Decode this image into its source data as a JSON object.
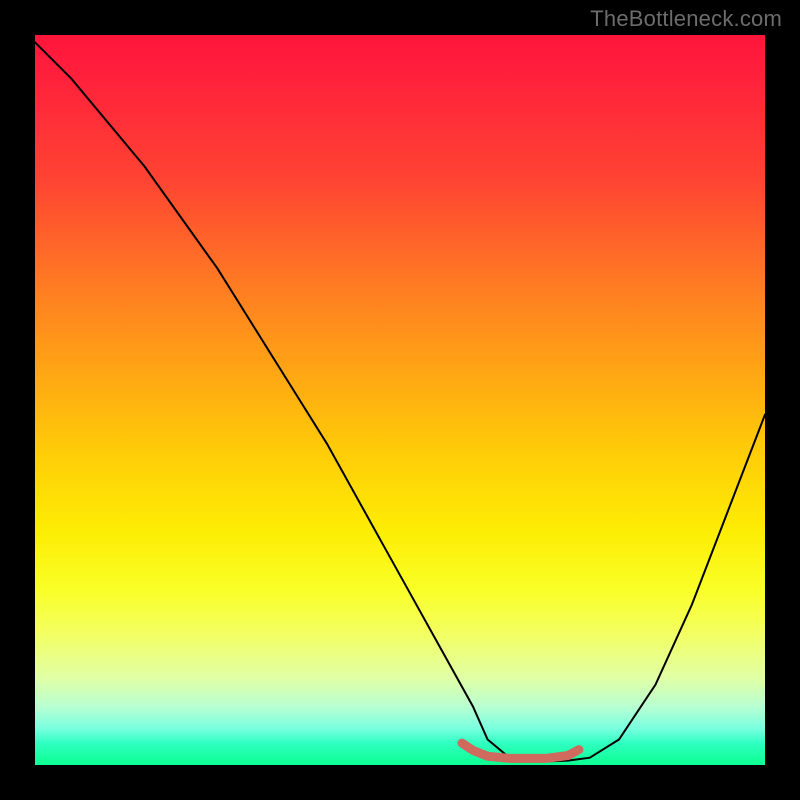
{
  "watermark": {
    "text": "TheBottleneck.com"
  },
  "chart_data": {
    "type": "line",
    "title": "",
    "xlabel": "",
    "ylabel": "",
    "xlim": [
      0,
      100
    ],
    "ylim": [
      0,
      100
    ],
    "grid": false,
    "legend": false,
    "background_gradient": {
      "direction": "vertical",
      "stops": [
        {
          "pos": 0,
          "color": "#ff153b"
        },
        {
          "pos": 20,
          "color": "#ff4432"
        },
        {
          "pos": 46,
          "color": "#ffa514"
        },
        {
          "pos": 68,
          "color": "#fded04"
        },
        {
          "pos": 88,
          "color": "#e1ffa5"
        },
        {
          "pos": 100,
          "color": "#0cff90"
        }
      ]
    },
    "series": [
      {
        "name": "bottleneck-curve",
        "color": "#000000",
        "x": [
          0,
          5,
          10,
          15,
          20,
          25,
          30,
          35,
          40,
          45,
          50,
          55,
          60,
          62,
          65,
          70,
          73,
          76,
          80,
          85,
          90,
          95,
          100
        ],
        "y": [
          99,
          94,
          88,
          82,
          75,
          68,
          60,
          52,
          44,
          35,
          26,
          17,
          8,
          3.5,
          1,
          0.5,
          0.6,
          1,
          3.5,
          11,
          22,
          35,
          48
        ]
      }
    ],
    "highlight": {
      "name": "optimal-range",
      "color": "#d06a5e",
      "x": [
        58.5,
        60,
        62,
        65,
        70,
        73,
        74.5
      ],
      "y": [
        3.0,
        2.0,
        1.2,
        0.9,
        0.9,
        1.3,
        2.1
      ]
    }
  }
}
